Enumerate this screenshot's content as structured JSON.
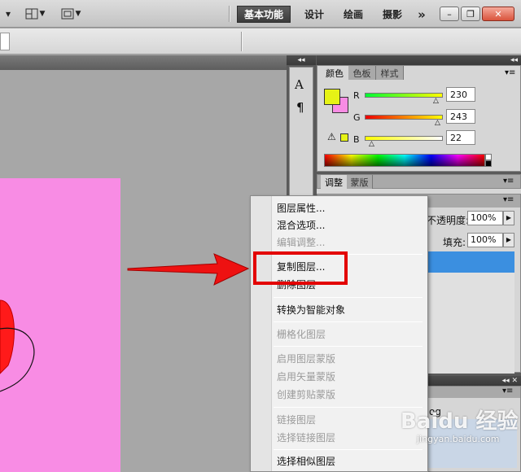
{
  "workspaces": {
    "essentials": "基本功能",
    "design": "设计",
    "painting": "绘画",
    "photography": "摄影",
    "more": "»"
  },
  "color_panel": {
    "tabs": [
      "颜色",
      "色板",
      "样式"
    ],
    "r_label": "R",
    "g_label": "G",
    "b_label": "B",
    "r_value": "230",
    "g_value": "243",
    "b_value": "22",
    "foreground_color": "#e6f316",
    "background_color": "#f88ce4"
  },
  "adjust_panel": {
    "tabs": [
      "调整",
      "蒙版"
    ]
  },
  "layers_panel": {
    "opacity_label": "不透明度:",
    "opacity_value": "100%",
    "fill_label": "填充:",
    "fill_value": "100%"
  },
  "small_panel": {
    "text": "og"
  },
  "context_menu": {
    "items": [
      {
        "label": "图层属性...",
        "enabled": true
      },
      {
        "label": "混合选项...",
        "enabled": true
      },
      {
        "label": "编辑调整...",
        "enabled": false
      },
      {
        "label": "复制图层...",
        "enabled": true
      },
      {
        "label": "删除图层",
        "enabled": true
      },
      {
        "label": "转换为智能对象",
        "enabled": true
      },
      {
        "label": "栅格化图层",
        "enabled": false
      },
      {
        "label": "启用图层蒙版",
        "enabled": false
      },
      {
        "label": "启用矢量蒙版",
        "enabled": false
      },
      {
        "label": "创建剪贴蒙版",
        "enabled": false
      },
      {
        "label": "链接图层",
        "enabled": false
      },
      {
        "label": "选择链接图层",
        "enabled": false
      },
      {
        "label": "选择相似图层",
        "enabled": true
      }
    ]
  },
  "watermark": {
    "brand": "Baidu 经验",
    "url": "jingyan.baidu.com"
  },
  "colors": {
    "annotation_red": "#e30000",
    "canvas_pink": "#f88ce4",
    "selection_blue": "#3b8fe0"
  }
}
